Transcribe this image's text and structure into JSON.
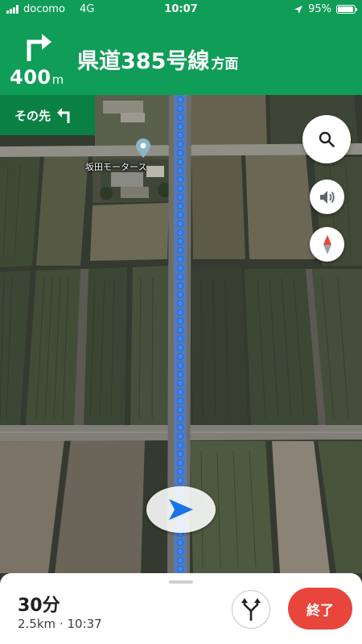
{
  "status_bar": {
    "carrier": "docomo",
    "network": "4G",
    "time": "10:07",
    "battery_percent": "95%",
    "battery_level": 0.95
  },
  "navigation": {
    "turn_icon": "turn-right-icon",
    "distance_value": "400",
    "distance_unit": "m",
    "road_name": "県道385号線",
    "road_suffix": "方面",
    "then_label": "その先",
    "then_icon": "turn-left-icon"
  },
  "map": {
    "place_label": "坂田モータース",
    "route_color": "#4285f4"
  },
  "controls": {
    "search_icon": "search-icon",
    "sound_icon": "volume-icon",
    "compass_icon": "compass-icon"
  },
  "trip": {
    "eta": "30分",
    "distance": "2.5km",
    "separator": "·",
    "arrival_time": "10:37",
    "end_label": "終了"
  },
  "colors": {
    "header_green": "#0f9d58",
    "then_green": "#0b8043",
    "end_red": "#e8453c",
    "nav_blue": "#1a73e8"
  }
}
